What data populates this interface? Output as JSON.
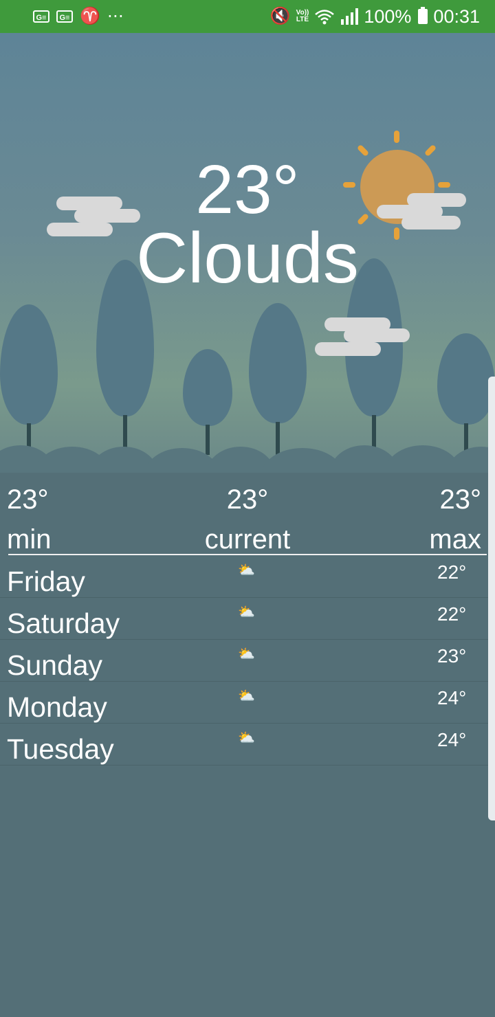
{
  "status_bar": {
    "left_icons": [
      "g-box-icon",
      "g-box-icon",
      "aries-icon",
      "more-dots-icon"
    ],
    "battery": "100%",
    "time": "00:31",
    "lte": "LTE",
    "volte": "Vo))"
  },
  "hero": {
    "temperature": "23°",
    "condition": "Clouds"
  },
  "summary": {
    "min": {
      "value": "23°",
      "label": "min"
    },
    "current": {
      "value": "23°",
      "label": "current"
    },
    "max": {
      "value": "23°",
      "label": "max"
    }
  },
  "forecast": [
    {
      "day": "Friday",
      "icon": "partly-cloudy-icon",
      "temp": "22°"
    },
    {
      "day": "Saturday",
      "icon": "partly-cloudy-icon",
      "temp": "22°"
    },
    {
      "day": "Sunday",
      "icon": "partly-cloudy-icon",
      "temp": "23°"
    },
    {
      "day": "Monday",
      "icon": "partly-cloudy-icon",
      "temp": "24°"
    },
    {
      "day": "Tuesday",
      "icon": "partly-cloudy-icon",
      "temp": "24°"
    }
  ],
  "colors": {
    "status_bar": "#3f9a3c",
    "panel": "#546f77",
    "sun": "#cc9a55",
    "sun_rays": "#e6a23a"
  }
}
